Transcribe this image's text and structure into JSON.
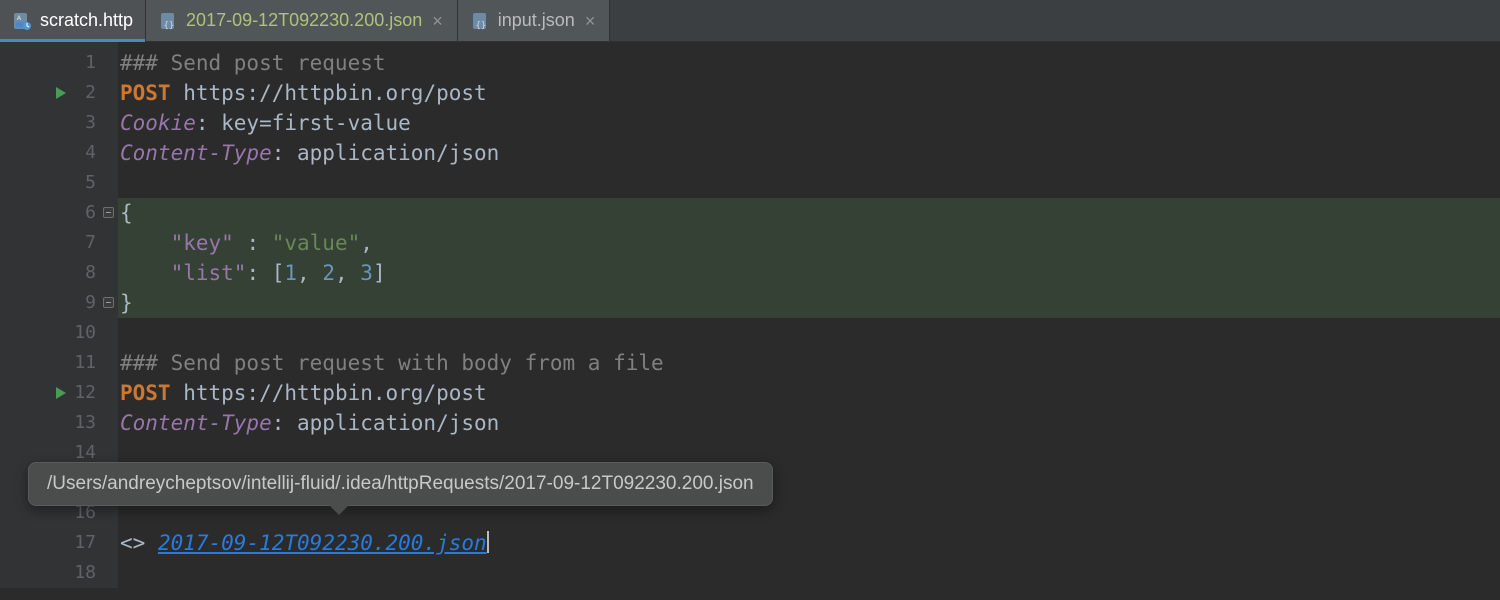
{
  "tabs": [
    {
      "label": "scratch.http",
      "active": true,
      "closable": false,
      "modified": false
    },
    {
      "label": "2017-09-12T092230.200.json",
      "active": false,
      "closable": true,
      "modified": true
    },
    {
      "label": "input.json",
      "active": false,
      "closable": true,
      "modified": false
    }
  ],
  "tooltip": "/Users/andreycheptsov/intellij-fluid/.idea/httpRequests/2017-09-12T092230.200.json",
  "gutter": {
    "lines": 18,
    "run_markers_at": [
      2,
      12
    ],
    "fold_markers_at": [
      6,
      9
    ]
  },
  "code": {
    "l1_comment": "### Send post request",
    "l2_method": "POST",
    "l2_url": " https://httpbin.org/post",
    "l3_header": "Cookie",
    "l3_value": ": key=first-value",
    "l4_header": "Content-Type",
    "l4_value": ": application/json",
    "l6_brace_open": "{",
    "l7_indent": "    ",
    "l7_key": "\"key\"",
    "l7_sep": " : ",
    "l7_val": "\"value\"",
    "l7_comma": ",",
    "l8_indent": "    ",
    "l8_key": "\"list\"",
    "l8_sep": ": ",
    "l8_br_open": "[",
    "l8_n1": "1",
    "l8_c1": ", ",
    "l8_n2": "2",
    "l8_c2": ", ",
    "l8_n3": "3",
    "l8_br_close": "]",
    "l9_brace_close": "}",
    "l11_comment": "### Send post request with body from a file",
    "l12_method": "POST",
    "l12_url": " https://httpbin.org/post",
    "l13_header": "Content-Type",
    "l13_value": ": application/json",
    "l17_prefix": "<> ",
    "l17_link": "2017-09-12T092230.200.json"
  }
}
